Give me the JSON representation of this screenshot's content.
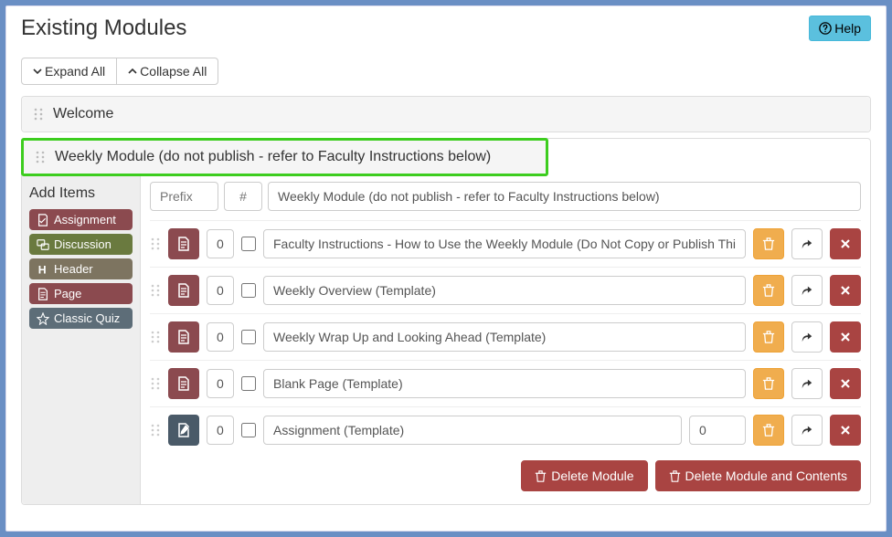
{
  "header": {
    "title": "Existing Modules",
    "help_label": "Help",
    "expand_label": "Expand All",
    "collapse_label": "Collapse All"
  },
  "modules": {
    "welcome": {
      "title": "Welcome"
    },
    "weekly": {
      "title": "Weekly Module (do not publish - refer to Faculty Instructions below)",
      "name_row": {
        "prefix_placeholder": "Prefix",
        "number_placeholder": "#",
        "title_value": "Weekly Module (do not publish - refer to Faculty Instructions below)"
      }
    }
  },
  "sidebar": {
    "title": "Add Items",
    "items": [
      {
        "label": "Assignment",
        "icon": "assignment"
      },
      {
        "label": "Discussion",
        "icon": "discussion"
      },
      {
        "label": "Header",
        "icon": "header"
      },
      {
        "label": "Page",
        "icon": "page"
      },
      {
        "label": "Classic Quiz",
        "icon": "quiz"
      }
    ]
  },
  "items": [
    {
      "indent": "0",
      "type": "page",
      "title": "Faculty Instructions - How to Use the Weekly Module (Do Not Copy or Publish This Page)",
      "points": null
    },
    {
      "indent": "0",
      "type": "page",
      "title": "Weekly Overview (Template)",
      "points": null
    },
    {
      "indent": "0",
      "type": "page",
      "title": "Weekly Wrap Up and Looking Ahead (Template)",
      "points": null
    },
    {
      "indent": "0",
      "type": "page",
      "title": "Blank Page (Template)",
      "points": null
    },
    {
      "indent": "0",
      "type": "assignment",
      "title": "Assignment (Template)",
      "points": "0"
    }
  ],
  "footer": {
    "delete_module": "Delete Module",
    "delete_module_contents": "Delete Module and Contents"
  }
}
